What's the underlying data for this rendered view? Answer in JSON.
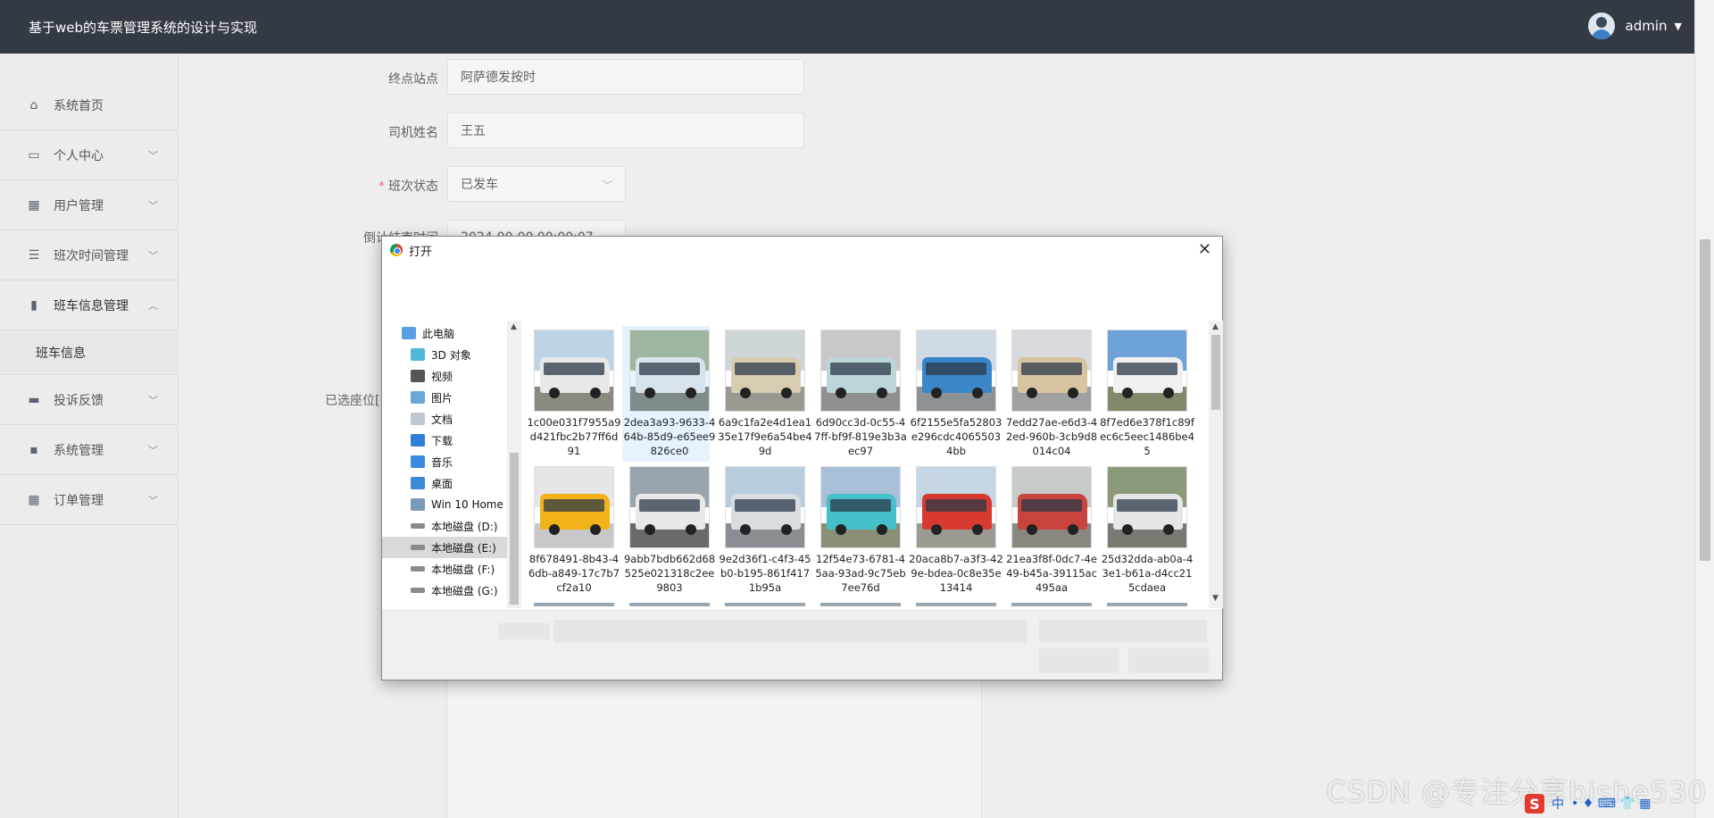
{
  "header": {
    "app_title": "基于web的车票管理系统的设计与实现",
    "user": "admin"
  },
  "sidebar": {
    "items": [
      {
        "label": "系统首页",
        "icon": "home-icon"
      },
      {
        "label": "个人中心",
        "icon": "window-icon"
      },
      {
        "label": "用户管理",
        "icon": "grid-icon"
      },
      {
        "label": "班次时间管理",
        "icon": "list-icon"
      },
      {
        "label": "班车信息管理",
        "icon": "clipboard-icon"
      },
      {
        "label": "班车信息",
        "icon": ""
      },
      {
        "label": "投诉反馈",
        "icon": "monitor-icon"
      },
      {
        "label": "系统管理",
        "icon": "chat-icon"
      },
      {
        "label": "订单管理",
        "icon": "grid-icon"
      }
    ]
  },
  "form": {
    "end_station_label": "终点站点",
    "end_station_value": "阿萨德发按时",
    "driver_label": "司机姓名",
    "driver_value": "王五",
    "status_label": "班次状态",
    "status_value": "已发车",
    "countdown_label": "倒计结束时间",
    "countdown_value": "2024-00-00 00:00:07",
    "seat_label": "已选座位[]"
  },
  "dialog": {
    "title": "打开",
    "nav": [
      {
        "label": "此电脑",
        "icon": "computer-icon"
      },
      {
        "label": "3D 对象",
        "icon": "cube-icon"
      },
      {
        "label": "视频",
        "icon": "video-icon"
      },
      {
        "label": "图片",
        "icon": "picture-icon"
      },
      {
        "label": "文档",
        "icon": "document-icon"
      },
      {
        "label": "下载",
        "icon": "download-icon"
      },
      {
        "label": "音乐",
        "icon": "music-icon"
      },
      {
        "label": "桌面",
        "icon": "desktop-icon"
      },
      {
        "label": "Win 10 Home ›",
        "icon": "drive-icon"
      },
      {
        "label": "本地磁盘 (D:)",
        "icon": "drive-icon"
      },
      {
        "label": "本地磁盘 (E:)",
        "icon": "drive-icon"
      },
      {
        "label": "本地磁盘 (F:)",
        "icon": "drive-icon"
      },
      {
        "label": "本地磁盘 (G:)",
        "icon": "drive-icon"
      }
    ],
    "files": [
      {
        "name": "1c00e031f7955a9d421fbc2b77ff6d91",
        "bus": "#e8e8e8",
        "sky": "#bcd4e6",
        "ground": "#8a8a80"
      },
      {
        "name": "2dea3a93-9633-464b-85d9-e65ee9826ce0",
        "bus": "#d8e2ea",
        "sky": "#9fb6a0",
        "ground": "#7f8a8a"
      },
      {
        "name": "6a9c1fa2e4d1ea135e17f9e6a54be49d",
        "bus": "#d8ccb0",
        "sky": "#cfd6d8",
        "ground": "#9a9890"
      },
      {
        "name": "6d90cc3d-0c55-47ff-bf9f-819e3b3aec97",
        "bus": "#bcd6d8",
        "sky": "#c8c8c8",
        "ground": "#909090"
      },
      {
        "name": "6f2155e5fa52803e296cdc40655034bb",
        "bus": "#3a86c8",
        "sky": "#d0dae4",
        "ground": "#8c9296"
      },
      {
        "name": "7edd27ae-e6d3-42ed-960b-3cb9d8014c04",
        "bus": "#d8c4a0",
        "sky": "#d8dade",
        "ground": "#a0a0a0"
      },
      {
        "name": "8f7ed6e378f1c89fec6c5eec1486be45",
        "bus": "#f0f0f0",
        "sky": "#6ea2d8",
        "ground": "#7f8a6a"
      },
      {
        "name": "8f678491-8b43-46db-a849-17c7b7cf2a10",
        "bus": "#f2b21a",
        "sky": "#e6e6e6",
        "ground": "#c8c8c8"
      },
      {
        "name": "9abb7bdb662d68525e021318c2ee9803",
        "bus": "#e8e8e8",
        "sky": "#9aa4ac",
        "ground": "#6a6a6a"
      },
      {
        "name": "9e2d36f1-c4f3-45b0-b195-861f4171b95a",
        "bus": "#d8dde2",
        "sky": "#b8cce0",
        "ground": "#8a8e92"
      },
      {
        "name": "12f54e73-6781-45aa-93ad-9c75eb7ee76d",
        "bus": "#46c0c8",
        "sky": "#a8c0d8",
        "ground": "#8a9078"
      },
      {
        "name": "20aca8b7-a3f3-429e-bdea-0c8e35e13414",
        "bus": "#d83a32",
        "sky": "#c4d6e4",
        "ground": "#9a9a92"
      },
      {
        "name": "21ea3f8f-0dc7-4e49-b45a-39115ac495aa",
        "bus": "#c8443c",
        "sky": "#c8ccc8",
        "ground": "#8a8680"
      },
      {
        "name": "25d32dda-ab0a-43e1-b61a-d4cc215cdaea",
        "bus": "#e6e6e6",
        "sky": "#8a9a7a",
        "ground": "#7a7a72"
      }
    ]
  },
  "watermark": "CSDN @专注分享bishe530",
  "ime": {
    "label": "中",
    "chars": "• ♦ ⌨ 👕 ▦"
  }
}
